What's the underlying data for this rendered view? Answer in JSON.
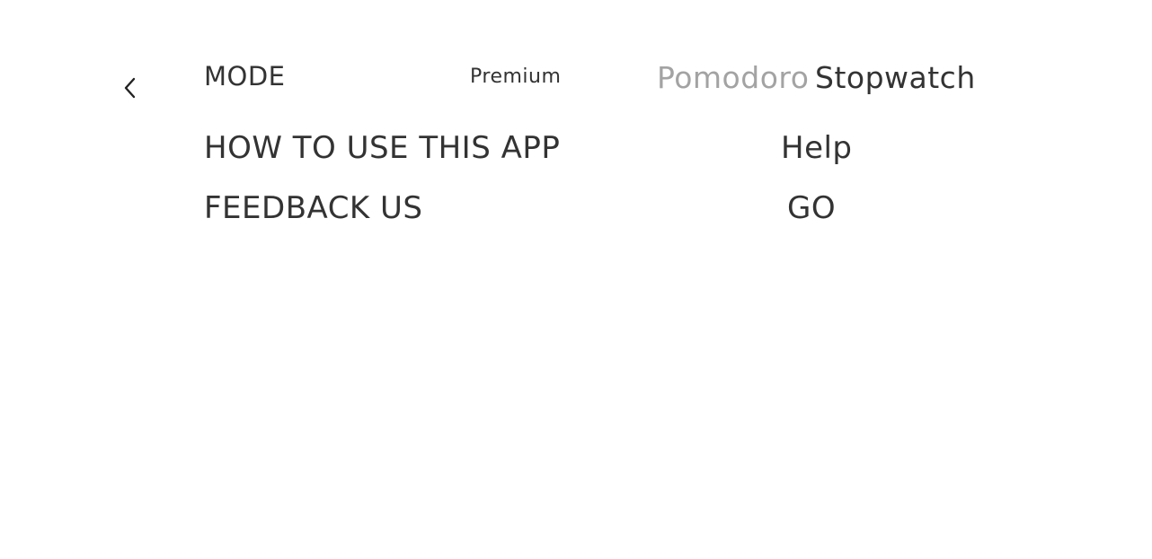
{
  "header": {
    "back_icon": "chevron-left-icon"
  },
  "mode": {
    "label": "MODE",
    "premium": "Premium",
    "options": [
      {
        "label": "Pomodoro",
        "selected": false,
        "color": "#a3a3a3"
      },
      {
        "label": "Stopwatch",
        "selected": true,
        "color": "#333333"
      }
    ]
  },
  "howto": {
    "label": "HOW TO USE THIS APP",
    "action": "Help"
  },
  "feedback": {
    "label": "FEEDBACK US",
    "action": "GO"
  }
}
